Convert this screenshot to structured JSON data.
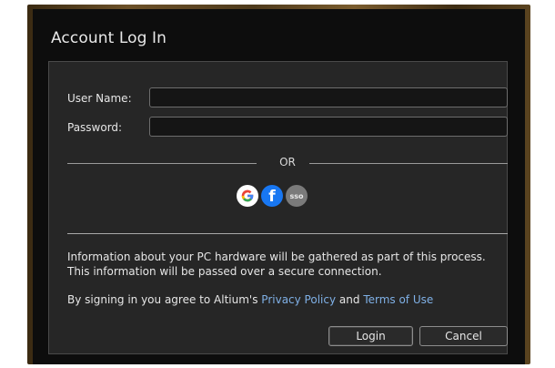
{
  "window": {
    "title": "Account Log In"
  },
  "form": {
    "username_label": "User Name:",
    "username_value": "",
    "password_label": "Password:",
    "password_value": ""
  },
  "divider": {
    "or_text": "OR"
  },
  "social": {
    "google_glyph": "G",
    "facebook_glyph": "f",
    "sso_text": "sso"
  },
  "info": {
    "hardware_notice": "Information about your PC hardware will be gathered as part of this process. This information will be passed over a secure connection.",
    "agree_prefix": "By signing in you agree to Altium's",
    "privacy_link": "Privacy Policy",
    "and_text": "and",
    "terms_link": "Terms of Use"
  },
  "buttons": {
    "login": "Login",
    "cancel": "Cancel"
  },
  "colors": {
    "link": "#7fb0e6",
    "facebook": "#1877f2",
    "panel": "#262626",
    "background": "#0d0d0d"
  }
}
